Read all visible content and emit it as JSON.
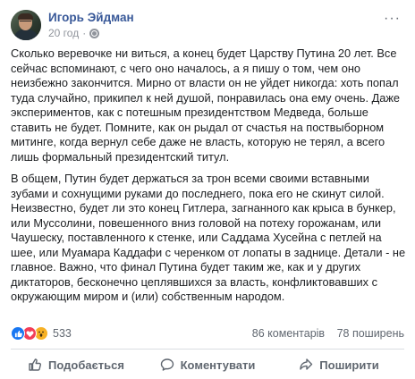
{
  "post": {
    "author": "Игорь Эйдман",
    "time": "20 год",
    "dot": "·",
    "more": "···",
    "paragraphs": [
      "Сколько веревочке ни виться, а конец будет Царству Путина 20 лет. Все сейчас вспоминают, с чего оно началось, а я пишу о том, чем оно неизбежно закончится. Мирно от власти он не уйдет никогда: хоть попал туда случайно, прикипел к ней душой, понравилась она ему очень. Даже экспериментов, как с потешным президентством Медведа, больше ставить не будет. Помните, как он рыдал от счастья на поствыборном митинге, когда вернул себе даже не власть, которую не терял, а всего лишь формальный президентский титул.",
      "В общем, Путин будет держаться за трон всеми своими вставными зубами и сохнущими руками до последнего, пока его не скинут силой. Неизвестно, будет ли это конец Гитлера, загнанного как крыса в бункер, или Муссолини, повешенного вниз головой на потеху горожанам, или Чаушеску, поставленного к стенке, или Саддама Хусейна с петлей на шее, или Муамара Каддафи с черенком от лопаты в заднице. Детали - не главное. Важно, что финал Путина будет таким же, как и у других диктаторов, бесконечно цеплявшихся за власть, конфликтовавших с окружающим миром и (или) собственным народом."
    ]
  },
  "stats": {
    "reaction_count": "533",
    "comments": "86 коментарів",
    "shares": "78 поширень"
  },
  "actions": {
    "like": "Подобається",
    "comment": "Коментувати",
    "share": "Поширити"
  }
}
